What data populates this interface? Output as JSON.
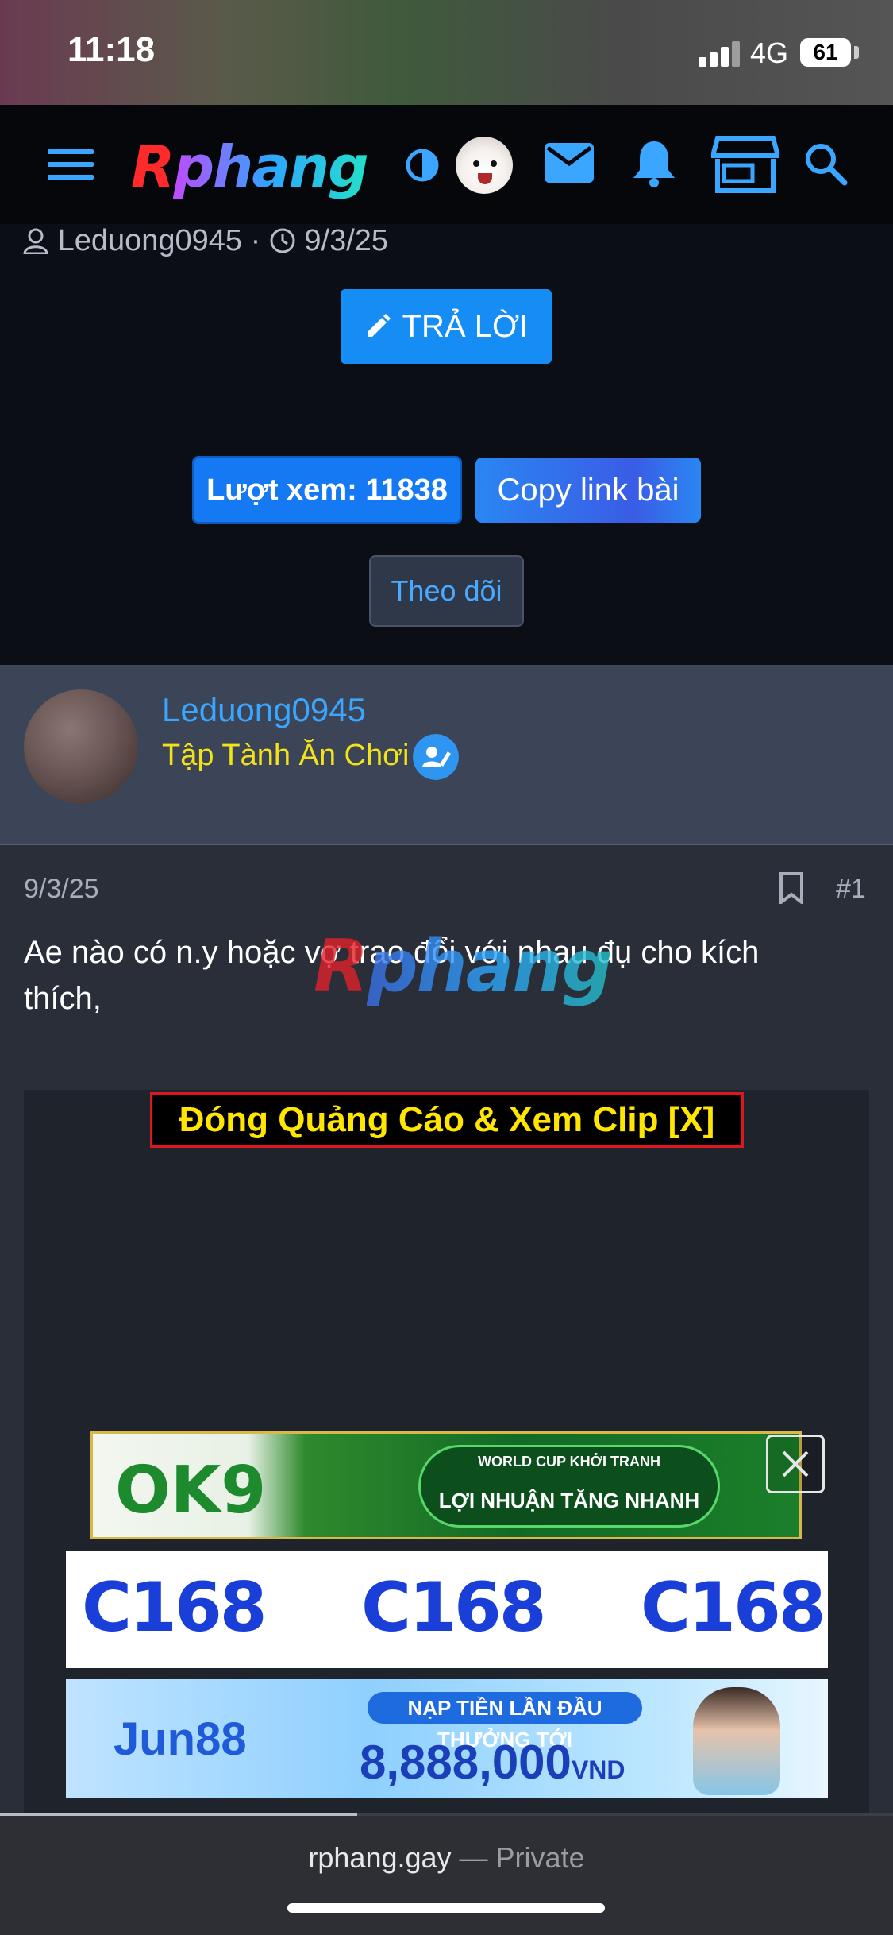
{
  "status_bar": {
    "time": "11:18",
    "network": "4G",
    "battery": "61"
  },
  "nav": {
    "logo_first": "R",
    "logo_rest": "phang",
    "icons": [
      "menu-icon",
      "contrast-icon",
      "avatar",
      "mail-icon",
      "bell-icon",
      "store-icon",
      "search-icon"
    ]
  },
  "thread": {
    "author": "Leduong0945",
    "date": "9/3/25",
    "reply_label": "TRẢ LỜI",
    "views_label": "Lượt xem: 11838",
    "copy_label": "Copy link bài",
    "follow_label": "Theo dõi"
  },
  "post": {
    "username": "Leduong0945",
    "rank": "Tập Tành Ăn Chơi",
    "date": "9/3/25",
    "number": "#1",
    "text": "Ae nào có n.y hoặc vợ trao đổi với nhau đụ cho kích thích,",
    "watermark_first": "R",
    "watermark_rest": "phang"
  },
  "ads": {
    "close_label": "Đóng Quảng Cáo & Xem Clip [X]",
    "ok9": {
      "brand": "OK9",
      "tag": "WORLD CUP KHỞI TRANH",
      "slogan": "LỢI NHUẬN TĂNG NHANH"
    },
    "c168": [
      "C168",
      "C168",
      "C168"
    ],
    "jun88": {
      "brand": "Jun88",
      "tag": "NẠP TIỀN LẦN ĐẦU THƯỞNG TỚI",
      "amount": "8,888,000",
      "currency": "VND"
    }
  },
  "footer": {
    "domain": "rphang.gay",
    "separator": " — ",
    "mode": "Private"
  },
  "colors": {
    "accent": "#168cf5",
    "link": "#3aa6ff",
    "rank": "#f2e21a",
    "ad_close_border": "#e0161e"
  }
}
